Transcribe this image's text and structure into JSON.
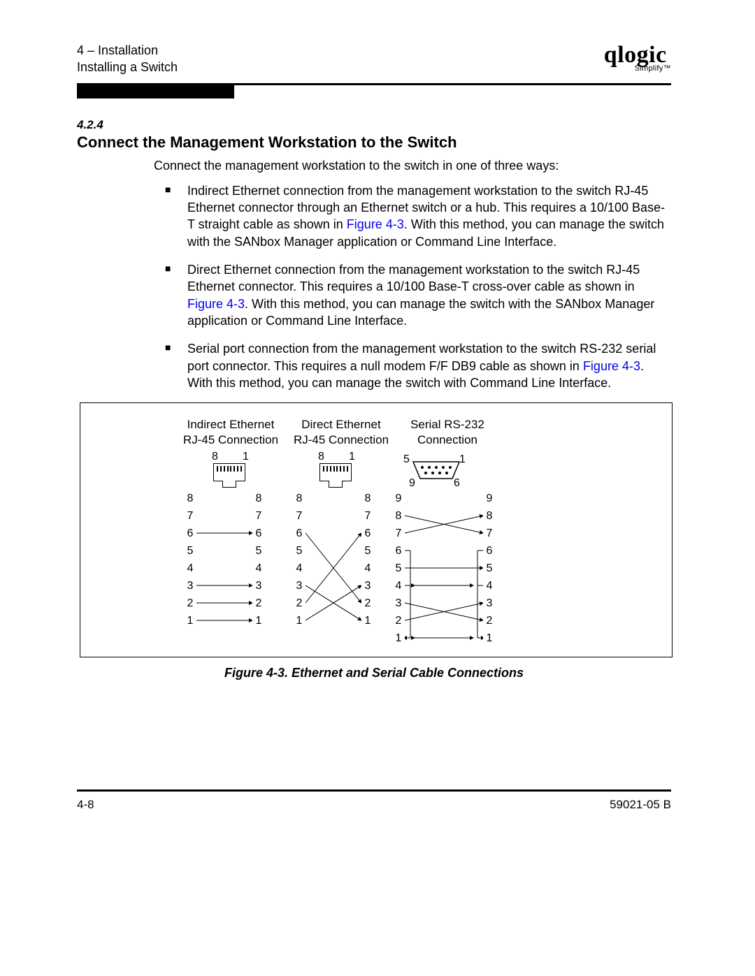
{
  "header": {
    "chapter": "4 – Installation",
    "subsection": "Installing a Switch",
    "brand": "qlogic",
    "brand_tag": "Simplify™"
  },
  "section": {
    "number": "4.2.4",
    "title": "Connect the Management Workstation to the Switch",
    "intro": "Connect the management workstation to the switch in one of three ways:"
  },
  "bullets": [
    {
      "pre": "Indirect Ethernet connection from the management workstation to the switch RJ-45 Ethernet connector through an Ethernet switch or a hub. This requires a 10/100 Base-T straight cable as shown in ",
      "link": "Figure 4-3",
      "post": ". With this method, you can manage the switch with the SANbox Manager application or Command Line Interface."
    },
    {
      "pre": "Direct Ethernet connection from the management workstation to the switch RJ-45 Ethernet connector. This requires a 10/100 Base-T cross-over cable as shown in ",
      "link": "Figure 4-3",
      "post": ". With this method, you can manage the switch with the SANbox Manager application or Command Line Interface."
    },
    {
      "pre": "Serial port connection from the management workstation to the switch RS-232 serial port connector. This requires a null modem F/F DB9 cable as shown in ",
      "link": "Figure 4-3",
      "post": ". With this method, you can manage the switch with Command Line Interface."
    }
  ],
  "figure": {
    "caption": "Figure 4-3.  Ethernet and Serial Cable Connections",
    "columns": [
      {
        "line1": "Indirect Ethernet",
        "line2": "RJ-45 Connection"
      },
      {
        "line1": "Direct Ethernet",
        "line2": "RJ-45 Connection"
      },
      {
        "line1": "Serial RS-232",
        "line2": "Connection"
      }
    ],
    "rj45_top_pins": {
      "left": "8",
      "right": "1"
    },
    "db9_top_pins": {
      "l": "5",
      "r": "1",
      "bl": "9",
      "br": "6"
    },
    "indirect_pins": [
      "8",
      "7",
      "6",
      "5",
      "4",
      "3",
      "2",
      "1"
    ],
    "direct_pins": [
      "8",
      "7",
      "6",
      "5",
      "4",
      "3",
      "2",
      "1"
    ],
    "serial_left": [
      "9",
      "8",
      "7",
      "6",
      "5",
      "4",
      "3",
      "2",
      "1"
    ],
    "serial_right": [
      "9",
      "8",
      "7",
      "6",
      "5",
      "4",
      "3",
      "2",
      "1"
    ]
  },
  "footer": {
    "page": "4-8",
    "docid": "59021-05  B"
  }
}
